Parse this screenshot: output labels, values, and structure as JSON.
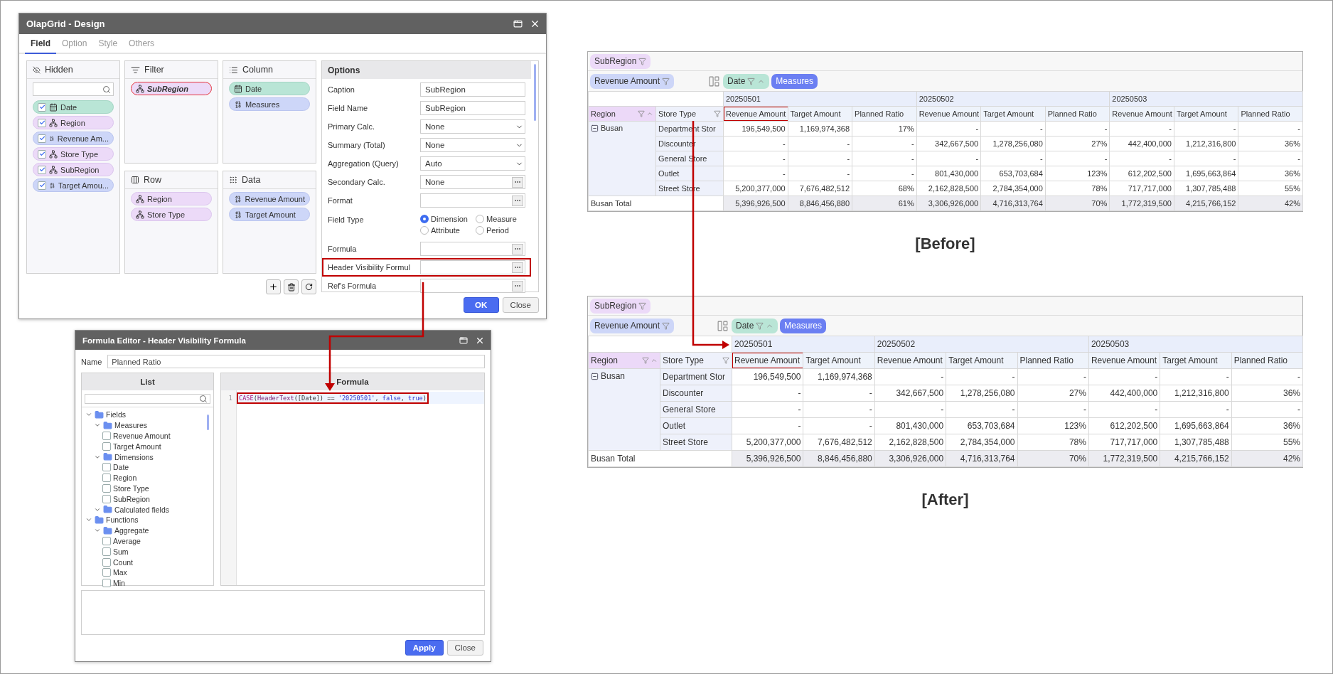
{
  "design_dialog": {
    "title": "OlapGrid - Design",
    "tabs": [
      {
        "label": "Field",
        "selected": true
      },
      {
        "label": "Option",
        "selected": false
      },
      {
        "label": "Style",
        "selected": false
      },
      {
        "label": "Others",
        "selected": false
      }
    ],
    "hidden": {
      "title": "Hidden",
      "fields": [
        {
          "label": "Date",
          "kind": "date",
          "checked": true
        },
        {
          "label": "Region",
          "kind": "dimension",
          "checked": true
        },
        {
          "label": "Revenue Am...",
          "kind": "measure",
          "checked": true
        },
        {
          "label": "Store Type",
          "kind": "dimension",
          "checked": true
        },
        {
          "label": "SubRegion",
          "kind": "dimension",
          "checked": true
        },
        {
          "label": "Target Amou...",
          "kind": "measure",
          "checked": true
        }
      ]
    },
    "filter": {
      "title": "Filter",
      "fields": [
        {
          "label": "SubRegion",
          "kind": "dimension",
          "highlighted": true
        }
      ]
    },
    "column": {
      "title": "Column",
      "fields": [
        {
          "label": "Date",
          "kind": "date"
        },
        {
          "label": "Measures",
          "kind": "measure"
        }
      ]
    },
    "row": {
      "title": "Row",
      "fields": [
        {
          "label": "Region",
          "kind": "dimension"
        },
        {
          "label": "Store Type",
          "kind": "dimension"
        }
      ]
    },
    "data": {
      "title": "Data",
      "fields": [
        {
          "label": "Revenue Amount",
          "kind": "measure"
        },
        {
          "label": "Target Amount",
          "kind": "measure"
        }
      ]
    },
    "options": {
      "title": "Options",
      "rows": [
        {
          "label": "Caption",
          "kind": "text",
          "value": "SubRegion",
          "highlighted": false
        },
        {
          "label": "Field Name",
          "kind": "text",
          "value": "SubRegion",
          "highlighted": false
        },
        {
          "label": "Primary Calc.",
          "kind": "select",
          "value": "None",
          "highlighted": false
        },
        {
          "label": "Summary (Total)",
          "kind": "select",
          "value": "None",
          "highlighted": false
        },
        {
          "label": "Aggregation (Query)",
          "kind": "select",
          "value": "Auto",
          "highlighted": false
        },
        {
          "label": "Secondary Calc.",
          "kind": "picker",
          "value": "None",
          "highlighted": false
        },
        {
          "label": "Format",
          "kind": "picker",
          "highlighted": false
        },
        {
          "label": "Field Type",
          "kind": "radio",
          "highlighted": false,
          "options": [
            {
              "label": "Dimension",
              "selected": true
            },
            {
              "label": "Measure",
              "selected": false
            },
            {
              "label": "Attribute",
              "selected": false
            },
            {
              "label": "Period",
              "selected": false
            }
          ]
        },
        {
          "label": "Formula",
          "kind": "picker",
          "highlighted": false
        },
        {
          "label": "Header Visibility Formul",
          "kind": "picker",
          "highlighted": true
        },
        {
          "label": "Ref's Formula",
          "kind": "picker",
          "highlighted": false
        }
      ]
    },
    "buttons": [
      {
        "label": "OK",
        "kind": "primary"
      },
      {
        "label": "Close",
        "kind": "secondary"
      }
    ]
  },
  "formula_editor": {
    "title": "Formula Editor - Header Visibility Formula",
    "name_label": "Name",
    "name_value": "Planned Ratio",
    "list_title": "List",
    "formula_title": "Formula",
    "tree": [
      {
        "label": "Fields",
        "kind": "folder",
        "expanded": true,
        "children": [
          {
            "label": "Measures",
            "kind": "folder",
            "expanded": true,
            "children": [
              {
                "label": "Revenue Amount",
                "kind": "item",
                "checked": false
              },
              {
                "label": "Target Amount",
                "kind": "item",
                "checked": false
              }
            ]
          },
          {
            "label": "Dimensions",
            "kind": "folder",
            "expanded": true,
            "children": [
              {
                "label": "Date",
                "kind": "item",
                "checked": false
              },
              {
                "label": "Region",
                "kind": "item",
                "checked": false
              },
              {
                "label": "Store Type",
                "kind": "item",
                "checked": false
              },
              {
                "label": "SubRegion",
                "kind": "item",
                "checked": false
              }
            ]
          },
          {
            "label": "Calculated fields",
            "kind": "folder",
            "expanded": true
          }
        ]
      },
      {
        "label": "Functions",
        "kind": "folder",
        "expanded": true,
        "children": [
          {
            "label": "Aggregate",
            "kind": "folder",
            "expanded": true,
            "children": [
              {
                "label": "Average",
                "kind": "item",
                "checked": false
              },
              {
                "label": "Sum",
                "kind": "item",
                "checked": false
              },
              {
                "label": "Count",
                "kind": "item",
                "checked": false
              },
              {
                "label": "Max",
                "kind": "item",
                "checked": false
              },
              {
                "label": "Min",
                "kind": "item",
                "checked": false
              }
            ]
          }
        ]
      }
    ],
    "code_lines": [
      {
        "number": "1",
        "highlighted": true,
        "tokens": [
          {
            "text": "CASE",
            "kind": "keyword"
          },
          {
            "text": "(",
            "kind": "punct"
          },
          {
            "text": "HeaderText",
            "kind": "function"
          },
          {
            "text": "([Date]) == ",
            "kind": "punct"
          },
          {
            "text": "'20250501'",
            "kind": "string"
          },
          {
            "text": ", ",
            "kind": "punct"
          },
          {
            "text": "false",
            "kind": "literal"
          },
          {
            "text": ", ",
            "kind": "punct"
          },
          {
            "text": "true",
            "kind": "literal"
          },
          {
            "text": ")",
            "kind": "punct"
          }
        ]
      }
    ],
    "buttons": [
      {
        "label": "Apply",
        "kind": "primary"
      },
      {
        "label": "Close",
        "kind": "secondary"
      }
    ]
  },
  "before_grid": {
    "caption": "[Before]",
    "filter_chips": [
      {
        "label": "SubRegion",
        "kind": "dimension"
      }
    ],
    "data_chips": [
      {
        "label": "Revenue Amount",
        "kind": "measure"
      }
    ],
    "column_chips": [
      {
        "label": "Date",
        "kind": "date"
      },
      {
        "label": "Measures",
        "kind": "measures"
      }
    ],
    "row_headers": [
      {
        "label": "Region",
        "sorted": true
      },
      {
        "label": "Store Type",
        "sorted": false
      }
    ],
    "dates": [
      {
        "label": "20250501",
        "highlighted": true,
        "measures": [
          "Revenue Amount",
          "Target Amount",
          "Planned Ratio"
        ]
      },
      {
        "label": "20250502",
        "highlighted": false,
        "measures": [
          "Revenue Amount",
          "Target Amount",
          "Planned Ratio"
        ]
      },
      {
        "label": "20250503",
        "highlighted": false,
        "measures": [
          "Revenue Amount",
          "Target Amount",
          "Planned Ratio"
        ]
      }
    ],
    "group": {
      "label": "Busan",
      "expanded": true
    },
    "rows": [
      {
        "label": "Department Stor",
        "values": [
          "196,549,500",
          "1,169,974,368",
          "17%",
          "-",
          "-",
          "-",
          "-",
          "-",
          "-"
        ]
      },
      {
        "label": "Discounter",
        "values": [
          "-",
          "-",
          "-",
          "342,667,500",
          "1,278,256,080",
          "27%",
          "442,400,000",
          "1,212,316,800",
          "36%"
        ]
      },
      {
        "label": "General Store",
        "values": [
          "-",
          "-",
          "-",
          "-",
          "-",
          "-",
          "-",
          "-",
          "-"
        ]
      },
      {
        "label": "Outlet",
        "values": [
          "-",
          "-",
          "-",
          "801,430,000",
          "653,703,684",
          "123%",
          "612,202,500",
          "1,695,663,864",
          "36%"
        ]
      },
      {
        "label": "Street Store",
        "values": [
          "5,200,377,000",
          "7,676,482,512",
          "68%",
          "2,162,828,500",
          "2,784,354,000",
          "78%",
          "717,717,000",
          "1,307,785,488",
          "55%"
        ]
      }
    ],
    "total": {
      "label": "Busan Total",
      "values": [
        "5,396,926,500",
        "8,846,456,880",
        "61%",
        "3,306,926,000",
        "4,716,313,764",
        "70%",
        "1,772,319,500",
        "4,215,766,152",
        "42%"
      ]
    }
  },
  "after_grid": {
    "caption": "[After]",
    "filter_chips": [
      {
        "label": "SubRegion",
        "kind": "dimension"
      }
    ],
    "data_chips": [
      {
        "label": "Revenue Amount",
        "kind": "measure"
      }
    ],
    "column_chips": [
      {
        "label": "Date",
        "kind": "date"
      },
      {
        "label": "Measures",
        "kind": "measures"
      }
    ],
    "row_headers": [
      {
        "label": "Region",
        "sorted": true
      },
      {
        "label": "Store Type",
        "sorted": false
      }
    ],
    "dates": [
      {
        "label": "20250501",
        "highlighted": true,
        "measures": [
          "Revenue Amount",
          "Target Amount"
        ]
      },
      {
        "label": "20250502",
        "highlighted": false,
        "measures": [
          "Revenue Amount",
          "Target Amount",
          "Planned Ratio"
        ]
      },
      {
        "label": "20250503",
        "highlighted": false,
        "measures": [
          "Revenue Amount",
          "Target Amount",
          "Planned Ratio"
        ]
      }
    ],
    "group": {
      "label": "Busan",
      "expanded": true
    },
    "rows": [
      {
        "label": "Department Stor",
        "values": [
          "196,549,500",
          "1,169,974,368",
          "-",
          "-",
          "-",
          "-",
          "-",
          "-"
        ]
      },
      {
        "label": "Discounter",
        "values": [
          "-",
          "-",
          "342,667,500",
          "1,278,256,080",
          "27%",
          "442,400,000",
          "1,212,316,800",
          "36%"
        ]
      },
      {
        "label": "General Store",
        "values": [
          "-",
          "-",
          "-",
          "-",
          "-",
          "-",
          "-",
          "-"
        ]
      },
      {
        "label": "Outlet",
        "values": [
          "-",
          "-",
          "801,430,000",
          "653,703,684",
          "123%",
          "612,202,500",
          "1,695,663,864",
          "36%"
        ]
      },
      {
        "label": "Street Store",
        "values": [
          "5,200,377,000",
          "7,676,482,512",
          "2,162,828,500",
          "2,784,354,000",
          "78%",
          "717,717,000",
          "1,307,785,488",
          "55%"
        ]
      }
    ],
    "total": {
      "label": "Busan Total",
      "values": [
        "5,396,926,500",
        "8,846,456,880",
        "3,306,926,000",
        "4,716,313,764",
        "70%",
        "1,772,319,500",
        "4,215,766,152",
        "42%"
      ]
    }
  }
}
